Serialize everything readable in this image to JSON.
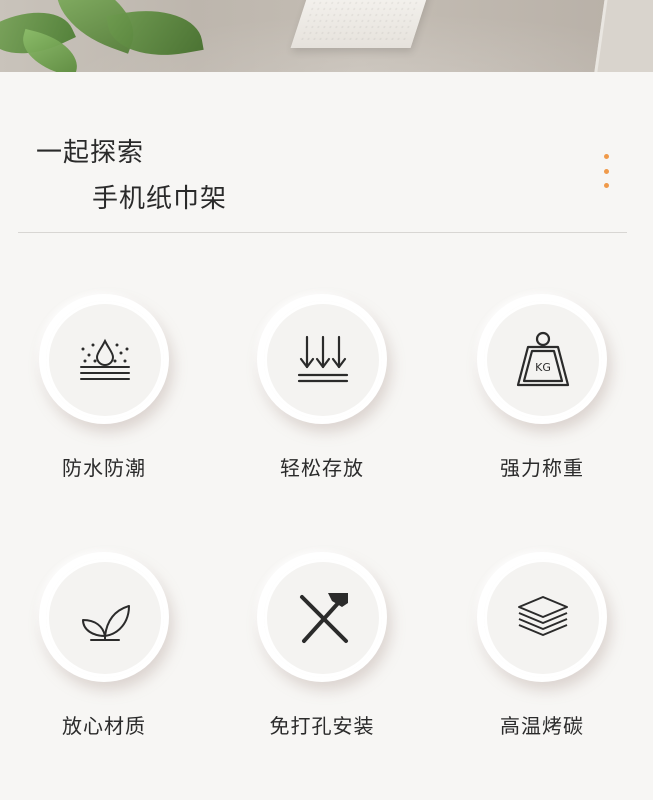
{
  "header": {
    "title_line1": "一起探索",
    "title_line2": "手机纸巾架",
    "more_icon": "more-vertical-icon",
    "accent_color": "#f09a4a"
  },
  "features": [
    {
      "label": "防水防潮",
      "icon": "waterproof-icon"
    },
    {
      "label": "轻松存放",
      "icon": "down-arrows-icon"
    },
    {
      "label": "强力称重",
      "icon": "kg-weight-icon",
      "icon_text": "KG"
    },
    {
      "label": "放心材质",
      "icon": "leaf-sprout-icon"
    },
    {
      "label": "免打孔安装",
      "icon": "no-drill-tools-icon"
    },
    {
      "label": "高温烤碳",
      "icon": "layers-stack-icon"
    }
  ],
  "colors": {
    "background": "#f7f6f4",
    "icon_stroke": "#2b2b2b",
    "text": "#2b2b2b"
  }
}
